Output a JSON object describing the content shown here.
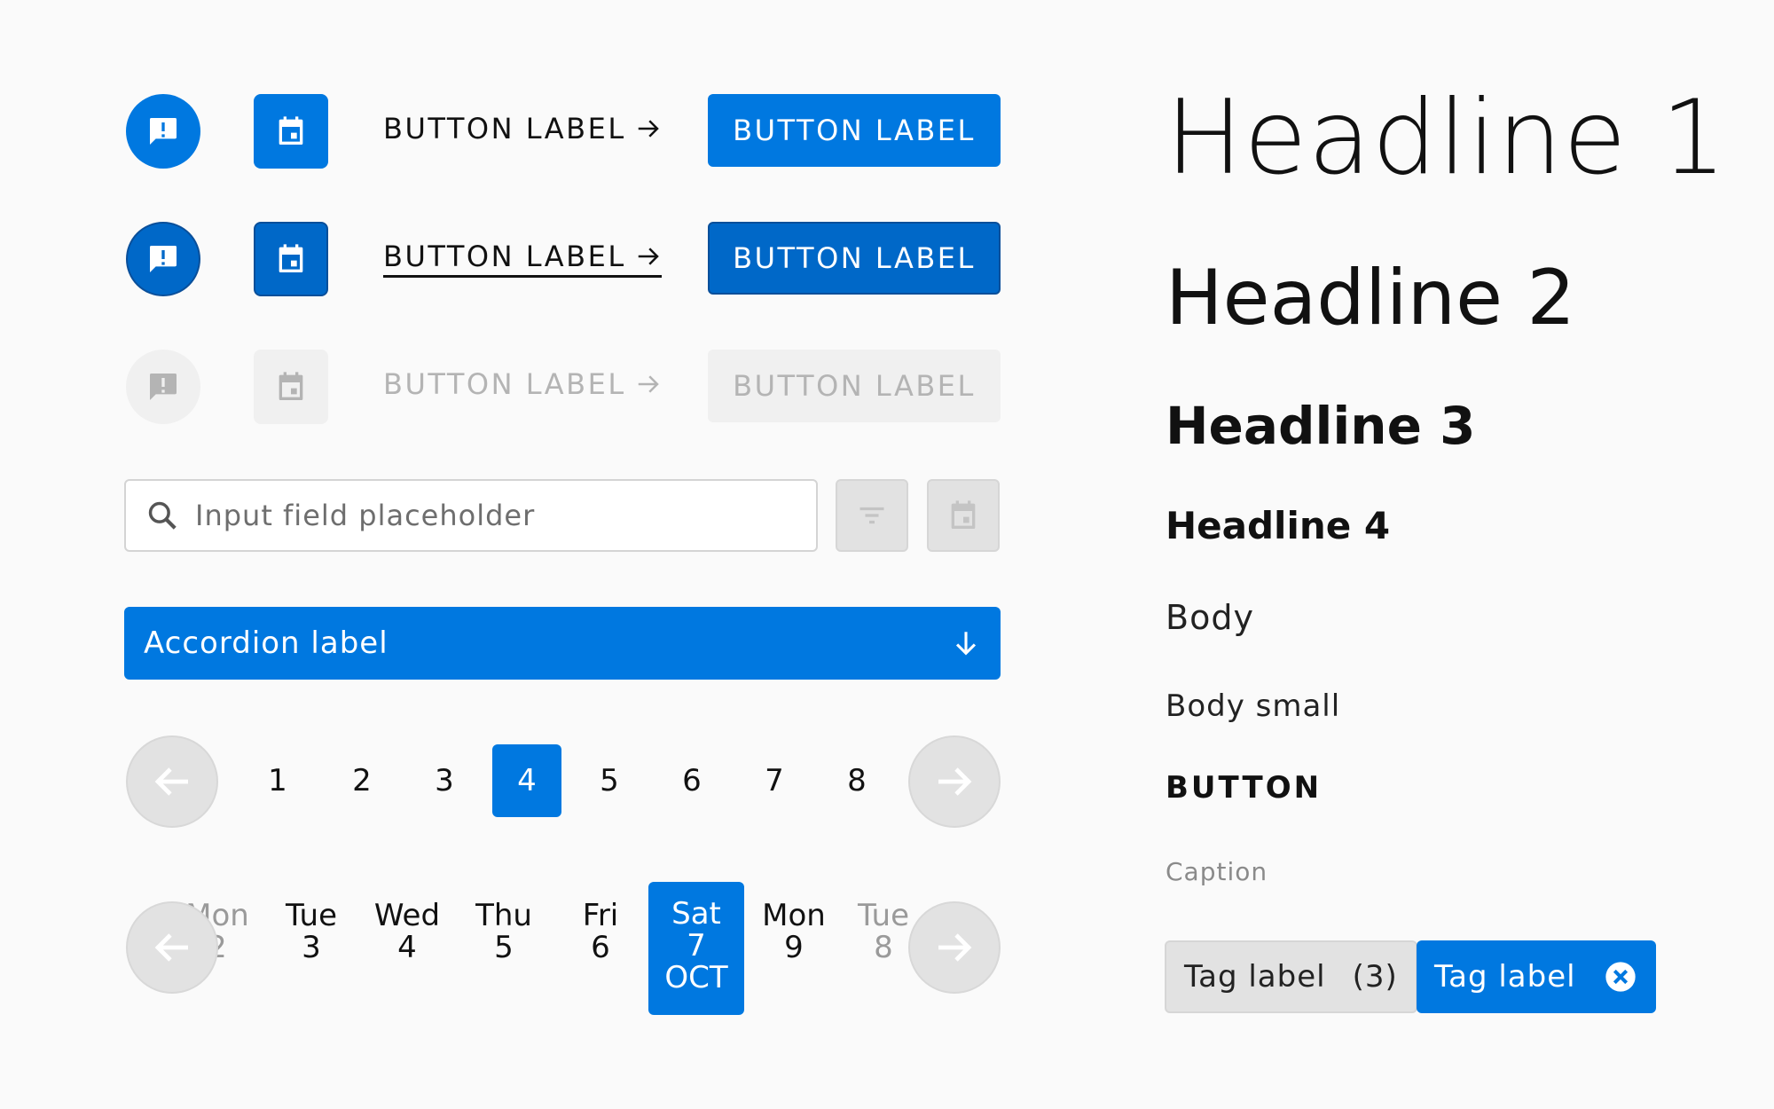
{
  "buttons": {
    "text_label": "BUTTON LABEL",
    "solid_label": "BUTTON LABEL"
  },
  "input": {
    "placeholder": "Input field placeholder"
  },
  "accordion": {
    "label": "Accordion label"
  },
  "pagination": {
    "pages": [
      "1",
      "2",
      "3",
      "4",
      "5",
      "6",
      "7",
      "8"
    ],
    "active": "4"
  },
  "date_picker": {
    "days": [
      {
        "name": "Mon",
        "num": "2",
        "state": "faded"
      },
      {
        "name": "Tue",
        "num": "3",
        "state": "normal"
      },
      {
        "name": "Wed",
        "num": "4",
        "state": "normal"
      },
      {
        "name": "Thu",
        "num": "5",
        "state": "normal"
      },
      {
        "name": "Fri",
        "num": "6",
        "state": "normal"
      },
      {
        "name": "Sat",
        "num": "7",
        "month": "OCT",
        "state": "active"
      },
      {
        "name": "Mon",
        "num": "9",
        "state": "normal"
      },
      {
        "name": "Tue",
        "num": "8",
        "state": "faded"
      }
    ]
  },
  "typography": {
    "h1": "Headline 1",
    "h2": "Headline 2",
    "h3": "Headline 3",
    "h4": "Headline 4",
    "body": "Body",
    "body_small": "Body small",
    "button": "BUTTON",
    "caption": "Caption"
  },
  "tags": {
    "grey_label": "Tag label",
    "grey_count": "(3)",
    "blue_label": "Tag label"
  },
  "icons": {
    "feedback": "feedback-icon",
    "calendar": "calendar-icon",
    "arrow_right": "arrow-right-icon",
    "search": "search-icon",
    "filter": "filter-icon",
    "arrow_down": "arrow-down-icon",
    "arrow_left": "arrow-left-icon",
    "close": "close-circle-icon"
  },
  "colors": {
    "primary": "#0078e0",
    "primary_dark": "#0068c8",
    "disabled_bg": "#f0f0f0",
    "disabled_text": "#b4b4b4",
    "background": "#fafafa"
  }
}
